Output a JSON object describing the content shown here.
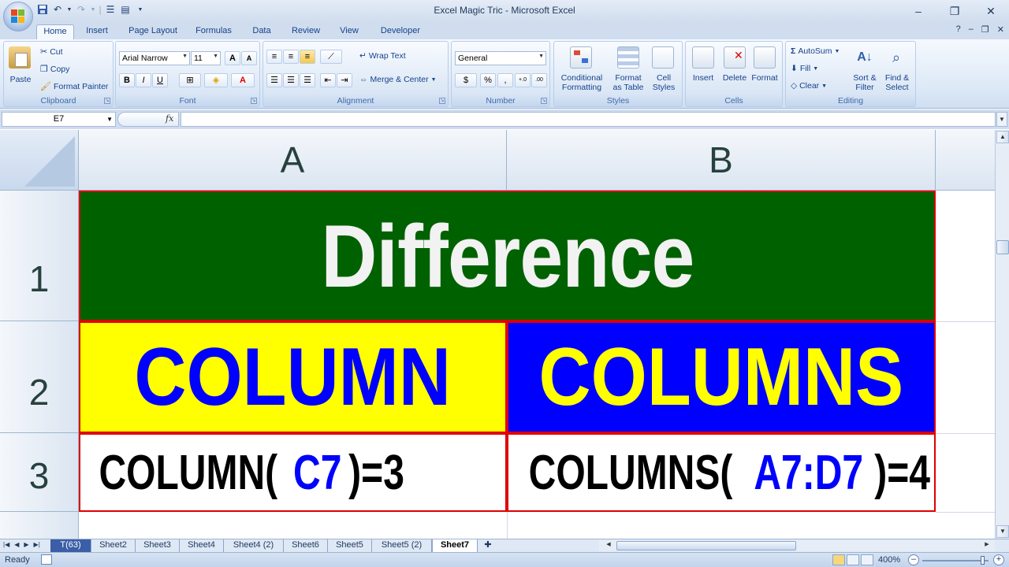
{
  "window": {
    "title": "Excel Magic Tric - Microsoft Excel",
    "minimize_glyph": "–",
    "restore_glyph": "❐",
    "close_glyph": "✕"
  },
  "quick_access": {
    "save_icon": "save-icon",
    "undo_icon": "undo-icon",
    "redo_icon": "redo-icon"
  },
  "tabs": [
    "Home",
    "Insert",
    "Page Layout",
    "Formulas",
    "Data",
    "Review",
    "View",
    "Developer"
  ],
  "active_tab": "Home",
  "ribbon": {
    "clipboard": {
      "label": "Clipboard",
      "paste": "Paste",
      "cut": "Cut",
      "copy": "Copy",
      "format_painter": "Format Painter"
    },
    "font": {
      "label": "Font",
      "font_name": "Arial Narrow",
      "font_size": "11",
      "grow_glyph": "A",
      "shrink_glyph": "A",
      "bold": "B",
      "italic": "I",
      "underline": "U",
      "font_color_glyph": "A"
    },
    "alignment": {
      "label": "Alignment",
      "wrap_text": "Wrap Text",
      "merge_center": "Merge & Center"
    },
    "number": {
      "label": "Number",
      "format": "General",
      "percent": "%",
      "comma": ",",
      "inc_decimal": "+.0",
      "dec_decimal": ".00"
    },
    "styles": {
      "label": "Styles",
      "conditional_formatting_1": "Conditional",
      "conditional_formatting_2": "Formatting",
      "format_table_1": "Format",
      "format_table_2": "as Table",
      "cell_styles_1": "Cell",
      "cell_styles_2": "Styles"
    },
    "cells": {
      "label": "Cells",
      "insert": "Insert",
      "delete": "Delete",
      "format": "Format"
    },
    "editing": {
      "label": "Editing",
      "autosum": "AutoSum",
      "fill": "Fill",
      "clear": "Clear",
      "sort_filter_1": "Sort &",
      "sort_filter_2": "Filter",
      "find_select_1": "Find &",
      "find_select_2": "Select"
    }
  },
  "formula_bar": {
    "name_box": "E7",
    "fx": "fx",
    "formula": ""
  },
  "grid": {
    "columns": [
      "A",
      "B"
    ],
    "rows": [
      "1",
      "2",
      "3"
    ],
    "cells": {
      "A1": "Difference",
      "A2": "COLUMN",
      "B2": "COLUMNS",
      "A3_prefix": "COLUMN(",
      "A3_ref": "C7",
      "A3_suffix": ")=3",
      "B3_prefix": "COLUMNS(",
      "B3_ref": "A7:D7",
      "B3_suffix": ")=4"
    },
    "colors": {
      "title_fill": "#006100",
      "column_fill": "#ffff00",
      "column_text": "#0000ff",
      "columns_fill": "#0000ff",
      "columns_text": "#ffff00",
      "border": "#e00000"
    }
  },
  "sheets": {
    "tabs": [
      "T(63)",
      "Sheet2",
      "Sheet3",
      "Sheet4",
      "Sheet4 (2)",
      "Sheet6",
      "Sheet5",
      "Sheet5 (2)",
      "Sheet7"
    ],
    "active": "Sheet7"
  },
  "status": {
    "ready": "Ready",
    "zoom": "400%"
  }
}
